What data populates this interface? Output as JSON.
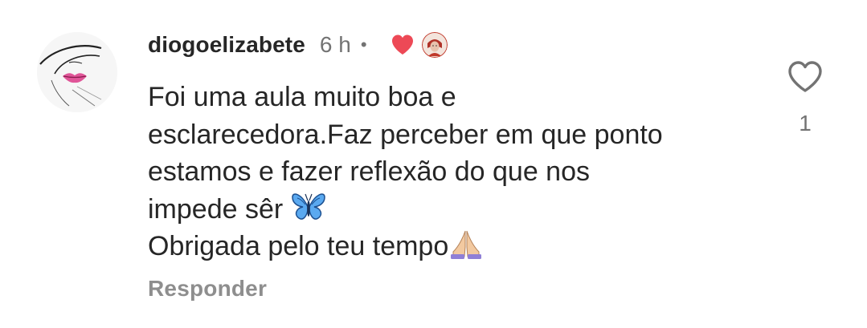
{
  "comment": {
    "username": "diogoelizabete",
    "time": "6 h",
    "separator": "•",
    "lines": [
      "Foi uma aula muito boa e",
      "esclarecedora.Faz perceber em que ponto",
      "estamos e fazer reflexão do que nos",
      "impede sêr",
      "Obrigada pelo teu tempo"
    ],
    "reply_label": "Responder",
    "like_count": "1",
    "icons": {
      "avatar": "lips-sketch-avatar",
      "author_liked": "red-heart-icon",
      "author_avatar": "author-avatar",
      "like": "heart-outline-icon",
      "emoji_1": "butterfly-emoji",
      "emoji_2": "praying-hands-emoji"
    },
    "colors": {
      "text": "#262626",
      "secondary": "#737373",
      "reply": "#8e8e8e",
      "heart": "#ed4956"
    }
  }
}
